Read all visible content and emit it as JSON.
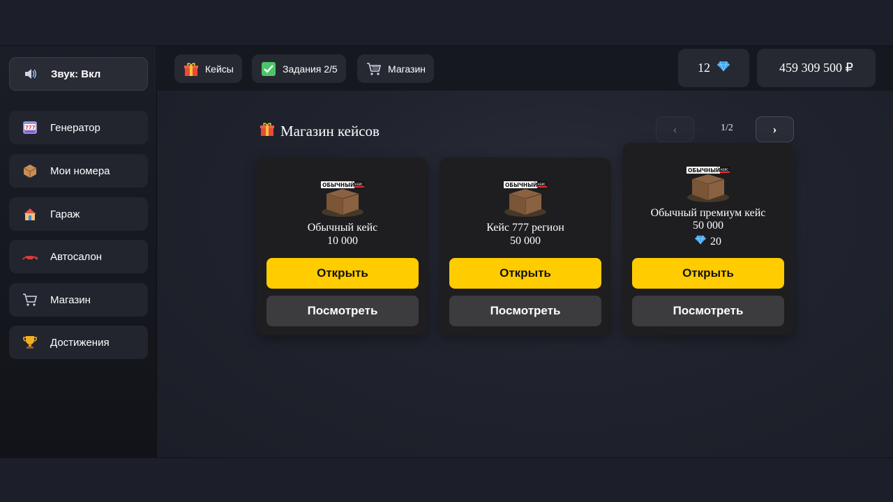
{
  "sidebar": {
    "sound": {
      "label": "Звук: Вкл",
      "icon": "speaker-icon"
    },
    "items": [
      {
        "label": "Генератор",
        "icon": "slot-machine-icon"
      },
      {
        "label": "Мои номера",
        "icon": "package-icon"
      },
      {
        "label": "Гараж",
        "icon": "house-icon"
      },
      {
        "label": "Автосалон",
        "icon": "race-car-icon"
      },
      {
        "label": "Магазин",
        "icon": "cart-icon"
      },
      {
        "label": "Достижения",
        "icon": "trophy-icon"
      }
    ]
  },
  "toolbar": {
    "cases_label": "Кейсы",
    "tasks_label": "Задания 2/5",
    "shop_label": "Магазин",
    "gems_count": "12",
    "balance": "459 309 500 ₽"
  },
  "shop": {
    "title": "Магазин кейсов",
    "page": "1/2",
    "prev_label": "‹",
    "next_label": "›"
  },
  "cases": [
    {
      "name": "Обычный кейс",
      "price": "10 000",
      "box_label": "ОБЫЧНЫЙ",
      "box_sub": "КЕЙС",
      "open_label": "Открыть",
      "view_label": "Посмотреть"
    },
    {
      "name": "Кейс 777 регион",
      "price": "50 000",
      "box_label": "ОБЫЧНЫЙ",
      "box_sub": "КЕЙС",
      "open_label": "Открыть",
      "view_label": "Посмотреть"
    },
    {
      "name": "Обычный премиум кейс",
      "price": "50 000",
      "gems": "20",
      "box_label": "ОБЫЧНЫЙ",
      "box_sub": "КЕЙС",
      "open_label": "Открыть",
      "view_label": "Посмотреть"
    }
  ],
  "colors": {
    "accent": "#ffcc00",
    "background": "#1b1e28",
    "card": "#1e1e20"
  }
}
